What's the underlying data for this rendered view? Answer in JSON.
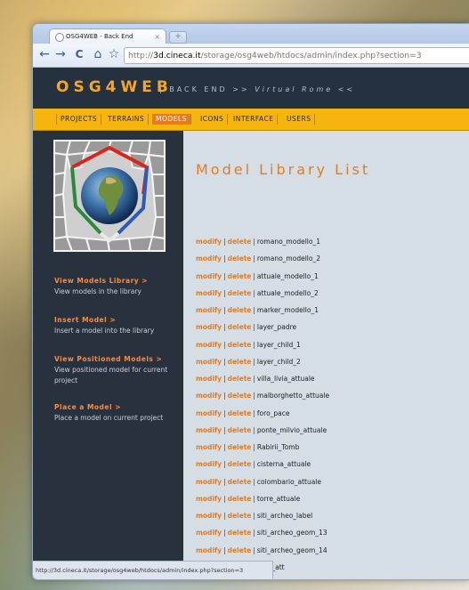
{
  "browser": {
    "tab_title": "OSG4WEB - Back End",
    "tab_close": "×",
    "new_tab": "+",
    "nav": {
      "back": "←",
      "forward": "→",
      "reload": "C",
      "home": "⌂",
      "star": "☆"
    },
    "url_prefix": "http://",
    "url_host": "3d.cineca.it",
    "url_path": "/storage/osg4web/htdocs/admin/index.php?section=3",
    "status_text": "http://3d.cineca.it/storage/osg4web/htdocs/admin/index.php?section=3"
  },
  "header": {
    "logo": "OSG4WEB",
    "tagline_prefix": "| BACK END >> ",
    "tagline_emph": "Virtual Rome",
    "tagline_suffix": " <<"
  },
  "menu": [
    {
      "label": "PROJECTS",
      "active": false
    },
    {
      "label": "TERRAINS",
      "active": false
    },
    {
      "label": "MODELS",
      "active": true
    },
    {
      "label": "ICONS",
      "active": false
    },
    {
      "label": "INTERFACE",
      "active": false
    },
    {
      "label": "USERS",
      "active": false
    }
  ],
  "sidebar": [
    {
      "link": "View Models Library >",
      "desc": "View models in the library"
    },
    {
      "link": "Insert Model >",
      "desc": "Insert a model into the library"
    },
    {
      "link": "View Positioned Models >",
      "desc": "View positioned model for current project"
    },
    {
      "link": "Place a Model >",
      "desc": "Place a model on current project"
    }
  ],
  "main": {
    "title": "Model Library List",
    "modify_label": "modify",
    "delete_label": "delete",
    "separator": "|",
    "models": [
      "romano_modello_1",
      "romano_modello_2",
      "attuale_modello_1",
      "attuale_modello_2",
      "marker_modello_1",
      "layer_padre",
      "layer_child_1",
      "layer_child_2",
      "villa_livia_attuale",
      "malborghetto_attuale",
      "foro_pace",
      "ponte_milvio_attuale",
      "Rabirii_Tomb",
      "cisterna_attuale",
      "colombario_attuale",
      "torre_attuale",
      "siti_archeo_label",
      "siti_archeo_geom_13",
      "siti_archeo_geom_14",
      "jeria_att"
    ]
  },
  "colors": {
    "accent": "#ea7a1c",
    "menubar": "#f6b40f",
    "header_bg": "#26313f",
    "sidebar_bg": "#28323e",
    "main_bg": "#d5dde5"
  }
}
